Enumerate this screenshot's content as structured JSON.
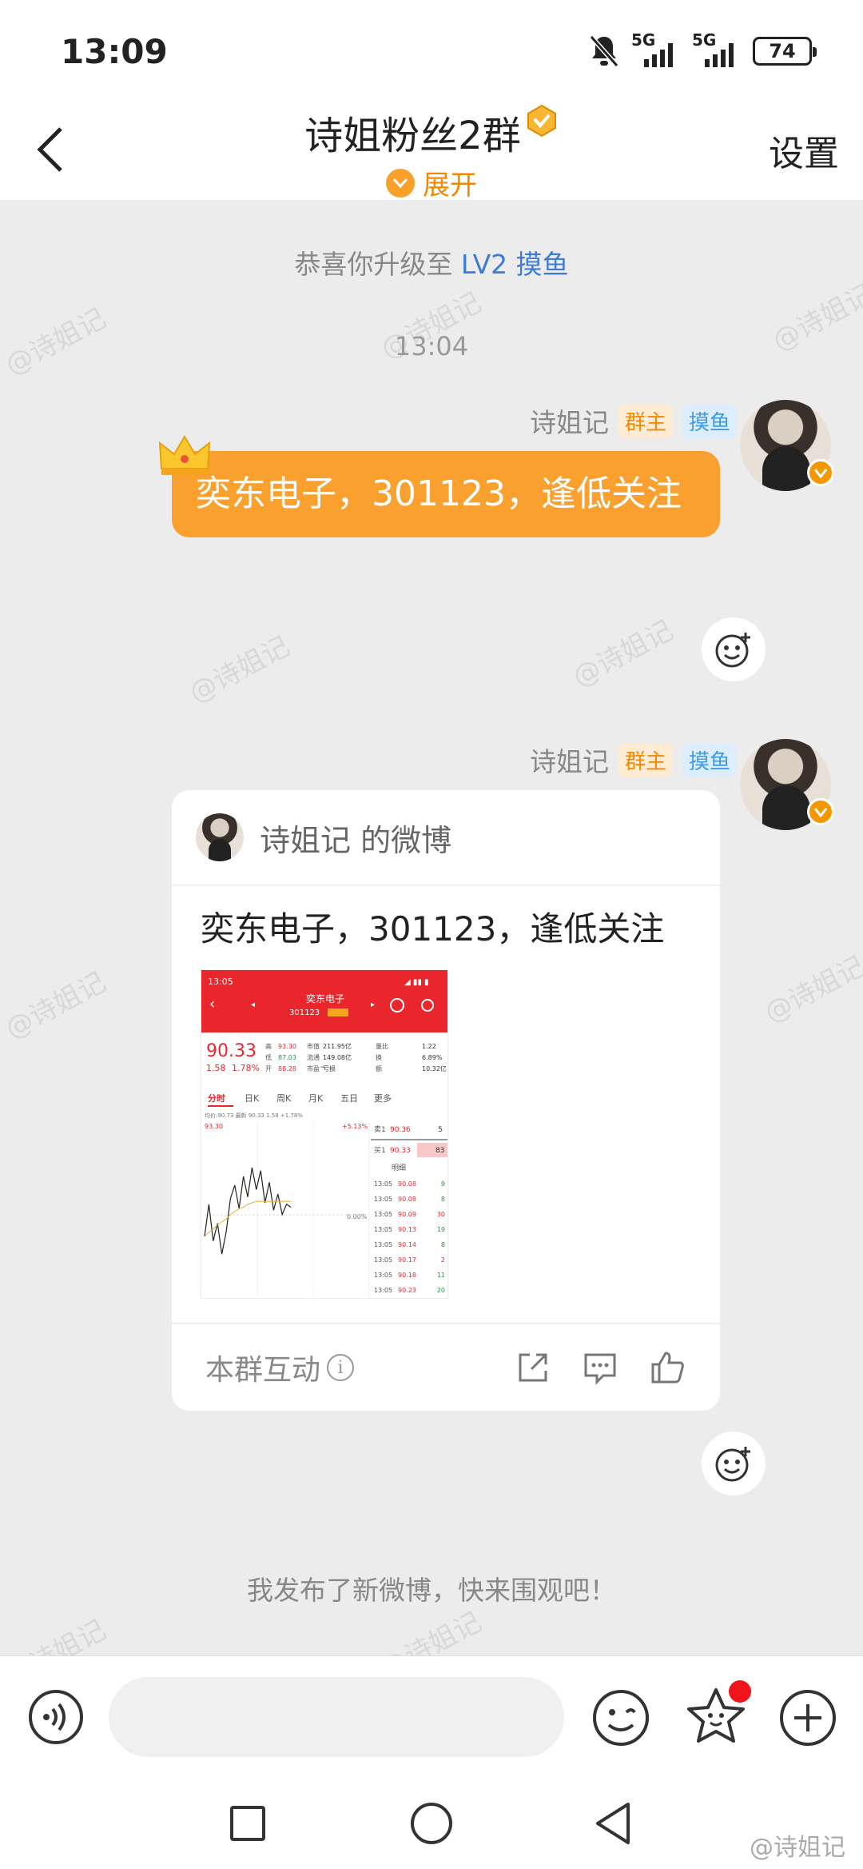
{
  "status_bar": {
    "time": "13:09",
    "network_1": "5G",
    "network_2": "5G",
    "battery": "74"
  },
  "header": {
    "title": "诗姐粉丝2群",
    "expand_label": "展开",
    "settings_label": "设置"
  },
  "chat": {
    "system_upgrade": {
      "prefix": "恭喜你升级至",
      "level": "LV2 摸鱼"
    },
    "timestamp": "13:04",
    "watermark": "@诗姐记",
    "messages": [
      {
        "sender": "诗姐记",
        "tag_owner": "群主",
        "tag_fish": "摸鱼",
        "text": "奕东电子，301123，逢低关注"
      },
      {
        "sender": "诗姐记",
        "tag_owner": "群主",
        "tag_fish": "摸鱼",
        "card": {
          "source": "诗姐记 的微博",
          "text": "奕东电子，301123，逢低关注",
          "footer_label": "本群互动"
        }
      }
    ],
    "system_post": "我发布了新微博，快来围观吧！"
  },
  "stock_thumb": {
    "time": "13:05",
    "name": "奕东电子",
    "code": "301123",
    "price": "90.33",
    "change": "1.58",
    "change_pct": "1.78%",
    "rows": [
      [
        "高",
        "93.30",
        "市值",
        "211.95亿",
        "量比",
        "1.22"
      ],
      [
        "低",
        "87.03",
        "流通",
        "149.08亿",
        "换",
        "6.89%"
      ],
      [
        "开",
        "88.28",
        "市盈™",
        "亏损",
        "额",
        "10.32亿"
      ]
    ],
    "tabs": [
      "分时",
      "日K",
      "周K",
      "月K",
      "五日",
      "更多"
    ],
    "line_info": "均价:90.73  最新 90.33  1.58  +1.78%",
    "y_top": "93.30",
    "y_pct": "+5.13%",
    "y_mid_pct": "0.00%",
    "sell1": [
      "卖1",
      "90.36",
      "5"
    ],
    "buy1": [
      "买1",
      "90.33",
      "83"
    ],
    "detail_label": "明细",
    "ticks": [
      [
        "13:05",
        "90.08",
        "9"
      ],
      [
        "13:05",
        "90.08",
        "8"
      ],
      [
        "13:05",
        "90.09",
        "30"
      ],
      [
        "13:05",
        "90.13",
        "19"
      ],
      [
        "13:05",
        "90.14",
        "8"
      ],
      [
        "13:05",
        "90.17",
        "2"
      ],
      [
        "13:05",
        "90.18",
        "11"
      ],
      [
        "13:05",
        "90.23",
        "20"
      ]
    ],
    "price_series": [
      88.3,
      90.5,
      88.0,
      89.2,
      87.1,
      88.6,
      90.9,
      91.8,
      90.2,
      92.4,
      91.0,
      93.0,
      91.5,
      92.8,
      90.6,
      92.0,
      90.1,
      91.2,
      89.8,
      90.5,
      90.3
    ],
    "avg_series": [
      88.3,
      88.6,
      88.8,
      89.1,
      89.3,
      89.5,
      89.8,
      90.0,
      90.2,
      90.3,
      90.5,
      90.6,
      90.7,
      90.7,
      90.7,
      90.7,
      90.7,
      90.7,
      90.7,
      90.7,
      90.7
    ]
  },
  "input_bar": {
    "placeholder": ""
  },
  "corner_watermark": "@诗姐记",
  "colors": {
    "accent_orange": "#f9a02e",
    "link_blue": "#3d7bd5",
    "notification_red": "#f3141b"
  }
}
